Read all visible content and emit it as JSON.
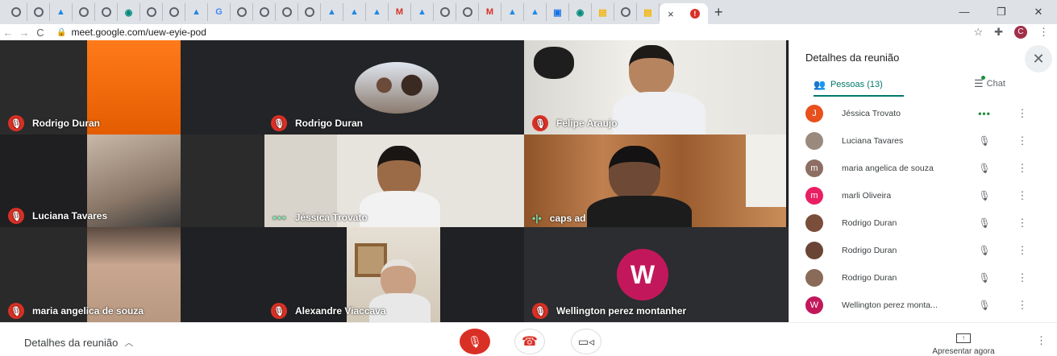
{
  "browser": {
    "tabs": [
      "chrome",
      "chrome",
      "drive",
      "chrome",
      "chrome",
      "meet",
      "chrome",
      "chrome",
      "drive",
      "G",
      "chrome",
      "chrome",
      "chrome",
      "chrome",
      "drive",
      "drive",
      "drive",
      "M",
      "drive",
      "chrome",
      "chrome",
      "M",
      "drive",
      "drive",
      "calendar",
      "meet",
      "slides",
      "chrome",
      "slides"
    ],
    "active_tab": {
      "close": "×",
      "indicator": "!"
    },
    "new_tab": "+",
    "window_controls": {
      "minimize": "—",
      "restore": "❐",
      "close": "✕"
    },
    "url": "meet.google.com/uew-eyie-pod",
    "nav": {
      "back": "←",
      "forward": "→",
      "reload": "C"
    },
    "profile_initial": "C"
  },
  "tiles": [
    {
      "name": "Rodrigo Duran",
      "indicator": "mic-off"
    },
    {
      "name": "Rodrigo Duran",
      "indicator": "mic-off"
    },
    {
      "name": "Felipe Araujo",
      "indicator": "mic-off"
    },
    {
      "name": "Luciana Tavares",
      "indicator": "mic-off"
    },
    {
      "name": "Jéssica Trovato",
      "indicator": "speaking-dots",
      "indicator_text": "•••"
    },
    {
      "name": "caps ad",
      "indicator": "audio-bars",
      "indicator_text": "•|•"
    },
    {
      "name": "maria angelica de souza",
      "indicator": "mic-off"
    },
    {
      "name": "Alexandre Viaccava",
      "indicator": "mic-off"
    },
    {
      "name": "Wellington perez montanher",
      "indicator": "mic-off",
      "avatar_letter": "W"
    }
  ],
  "panel": {
    "title": "Detalhes da reunião",
    "close": "✕",
    "tab_people": "Pessoas (13)",
    "tab_chat": "Chat",
    "people": [
      {
        "name": "Jéssica Trovato",
        "initial": "J",
        "color": "#e8501e",
        "status": "•••",
        "active": true
      },
      {
        "name": "Luciana Tavares",
        "initial": "",
        "color": "#9a8a7e",
        "status": "🎙",
        "active": false
      },
      {
        "name": "maria angelica de souza",
        "initial": "m",
        "color": "#8d6e63",
        "status": "🎙",
        "active": false
      },
      {
        "name": "marli Oliveira",
        "initial": "m",
        "color": "#e91e63",
        "status": "🎙",
        "active": false
      },
      {
        "name": "Rodrigo Duran",
        "initial": "",
        "color": "#7a4e3a",
        "status": "🎙",
        "active": false
      },
      {
        "name": "Rodrigo Duran",
        "initial": "",
        "color": "#6a4536",
        "status": "🎙",
        "active": false
      },
      {
        "name": "Rodrigo Duran",
        "initial": "",
        "color": "#8a6a58",
        "status": "🎙",
        "active": false
      },
      {
        "name": "Wellington perez monta...",
        "initial": "W",
        "color": "#c2185b",
        "status": "🎙",
        "active": false
      }
    ]
  },
  "bottom": {
    "meeting_details": "Detalhes da reunião",
    "present_now": "Apresentar agora",
    "more": "⋮"
  }
}
